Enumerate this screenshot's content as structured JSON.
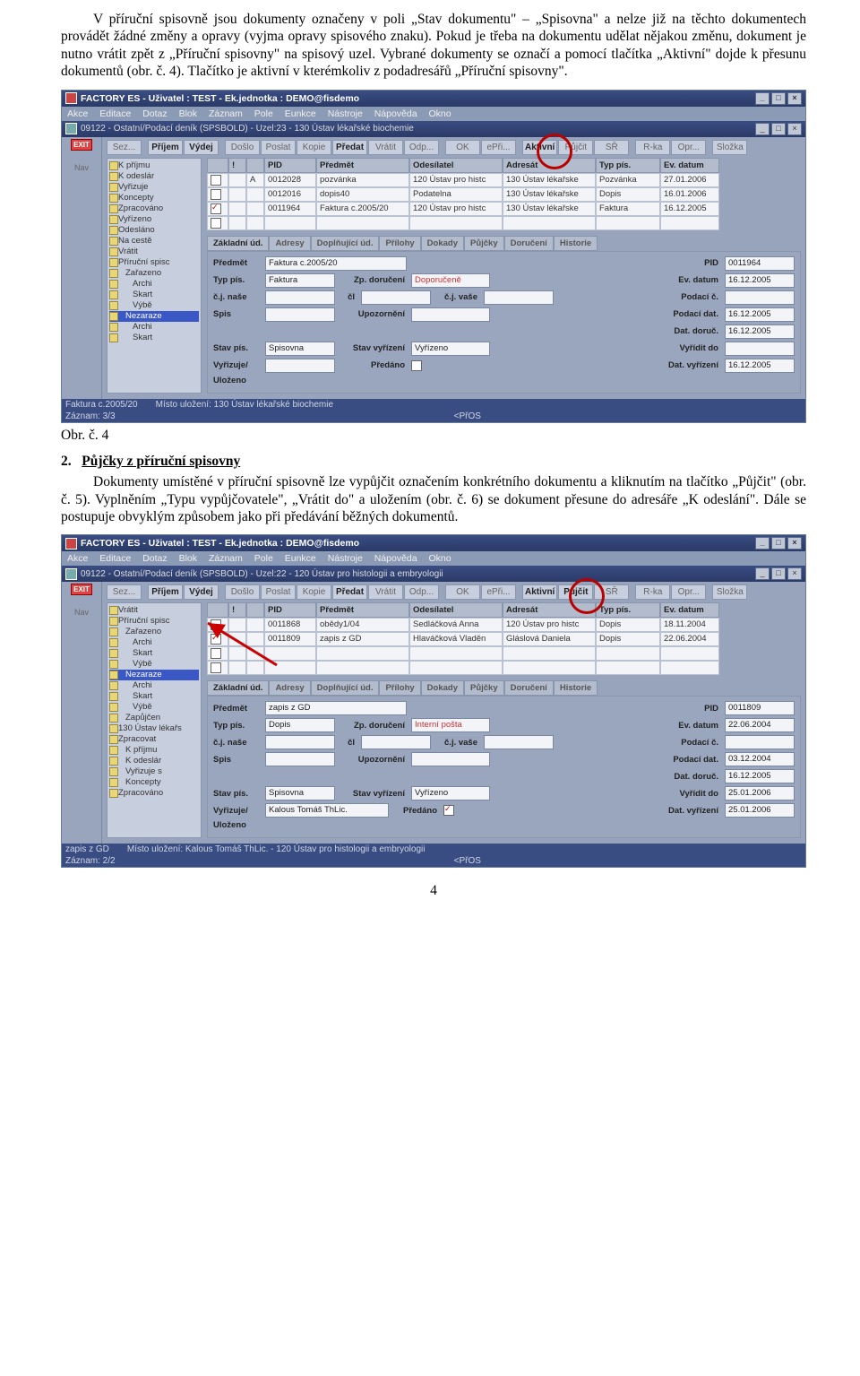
{
  "para1": "V příruční spisovně jsou dokumenty označeny v poli „Stav dokumentu\" – „Spisovna\" a nelze již na těchto dokumentech provádět žádné změny a opravy (vyjma opravy spisového znaku). Pokud je třeba na dokumentu udělat nějakou změnu, dokument je nutno vrátit zpět z „Příruční spisovny\" na spisový uzel. Vybrané dokumenty se označí a pomocí tlačítka „Aktivní\" dojde k přesunu dokumentů (obr. č. 4). Tlačítko je aktivní v kterémkoliv z podadresářů „Příruční spisovny\".",
  "caption1": "Obr. č. 4",
  "sec_num": "2.",
  "sec_title": "Půjčky z příruční spisovny",
  "para2": "Dokumenty umístěné v příruční spisovně lze vypůjčit označením konkrétního dokumentu a kliknutím na tlačítko „Půjčit\" (obr. č. 5). Vyplněním „Typu vypůjčovatele\", „Vrátit do\" a uložením (obr. č. 6) se dokument přesune do adresáře „K odeslání\". Dále se postupuje obvyklým způsobem jako při předávání běžných dokumentů.",
  "page": "4",
  "s1": {
    "title": "FACTORY ES - Uživatel : TEST - Ek.jednotka : DEMO@fisdemo",
    "menu": [
      "Akce",
      "Editace",
      "Dotaz",
      "Blok",
      "Záznam",
      "Pole",
      "Eunkce",
      "Nástroje",
      "Nápověda",
      "Okno"
    ],
    "doc": "09122 - Ostatní/Podací deník (SPSBOLD) - Uzel:23 - 130 Ústav lékařské biochemie",
    "btns": [
      "Sez...",
      "Příjem",
      "Výdej",
      "Došlo",
      "Poslat",
      "Kopie",
      "Předat",
      "Vrátit",
      "Odp...",
      "OK",
      "ePři...",
      "Aktivní",
      "Půjčit",
      "SŘ",
      "R-ka",
      "Opr...",
      "Složka"
    ],
    "nav": "Nav",
    "tree": [
      "K příjmu",
      "K odeslár",
      "Vyřizuje",
      "Koncepty",
      "Zpracováno",
      "Vyřízeno",
      "Odesláno",
      "Na cestě",
      "Vrátit",
      "Příruční spisc",
      "Zařazeno",
      "Archi",
      "Skart",
      "Výbě",
      "Nezaraze",
      "Archi",
      "Skart"
    ],
    "tree_sel": "Nezaraze",
    "gh": [
      "",
      "!",
      "",
      "PID",
      "Předmět",
      "Odesílatel",
      "Adresát",
      "Typ pís.",
      "Ev. datum"
    ],
    "rows": [
      {
        "ck": false,
        "mk": "",
        "t": "A",
        "pid": "0012028",
        "pred": "pozvánka",
        "od": "120 Ústav pro histc",
        "ad": "130 Ústav lékařske",
        "typ": "Pozvánka",
        "dt": "27.01.2006"
      },
      {
        "ck": false,
        "mk": "",
        "t": "",
        "pid": "0012016",
        "pred": "dopis40",
        "od": "Podatelna",
        "ad": "130 Ústav lékařske",
        "typ": "Dopis",
        "dt": "16.01.2006"
      },
      {
        "ck": true,
        "mk": "",
        "t": "",
        "pid": "0011964",
        "pred": "Faktura c.2005/20",
        "od": "120 Ústav pro histc",
        "ad": "130 Ústav lékařske",
        "typ": "Faktura",
        "dt": "16.12.2005"
      }
    ],
    "tabs": [
      "Základní úd.",
      "Adresy",
      "Doplňující úd.",
      "Přílohy",
      "Dokady",
      "Půjčky",
      "Doručení",
      "Historie"
    ],
    "form": {
      "predmet_l": "Předmět",
      "predmet": "Faktura c.2005/20",
      "typ_l": "Typ pís.",
      "typ": "Faktura",
      "cjnase_l": "č.j. naše",
      "cjnase": "",
      "spis_l": "Spis",
      "spis": "",
      "stav_l": "Stav pís.",
      "stav": "Spisovna",
      "vyr_l": "Vyřizuje/",
      "vyr": "",
      "ul_l": "Uloženo",
      "zp_l": "Zp. doručení",
      "zp": "Doporučeně",
      "cl_l": "čl",
      "cjvase_l": "č.j. vaše",
      "cjvase": "",
      "upoz_l": "Upozornění",
      "upoz": "",
      "stavv_l": "Stav vyřízení",
      "stavv": "Vyřízeno",
      "pred_l": "Předáno",
      "pid_l": "PID",
      "pid": "0011964",
      "evd_l": "Ev. datum",
      "evd": "16.12.2005",
      "pod_l": "Podací č.",
      "pod": "",
      "podd_l": "Podací dat.",
      "podd": "16.12.2005",
      "datd_l": "Dat. doruč.",
      "datd": "16.12.2005",
      "vyrd_l": "Vyřídit do",
      "vyrd": "",
      "datv_l": "Dat. vyřízení",
      "datv": "16.12.2005"
    },
    "status": [
      "Faktura c.2005/20",
      "Místo uložení: 130 Ústav lékařské biochemie"
    ],
    "status2": [
      "Záznam: 3/3",
      "",
      "<PřOS"
    ]
  },
  "s2": {
    "title": "FACTORY ES - Uživatel : TEST - Ek.jednotka : DEMO@fisdemo",
    "menu": [
      "Akce",
      "Editace",
      "Dotaz",
      "Blok",
      "Záznam",
      "Pole",
      "Eunkce",
      "Nástroje",
      "Nápověda",
      "Okno"
    ],
    "doc": "09122 - Ostatní/Podací deník (SPSBOLD) - Uzel:22 - 120 Ústav pro histologii a embryologii",
    "btns": [
      "Sez...",
      "Příjem",
      "Výdej",
      "Došlo",
      "Poslat",
      "Kopie",
      "Předat",
      "Vrátit",
      "Odp...",
      "OK",
      "ePři...",
      "Aktivní",
      "Půjčit",
      "SŘ",
      "R-ka",
      "Opr...",
      "Složka"
    ],
    "tree": [
      "Vrátit",
      "Příruční spisc",
      "Zařazeno",
      "Archi",
      "Skart",
      "Výbě",
      "Nezaraze",
      "Archi",
      "Skart",
      "Výbě",
      "Zapůjčen",
      "130 Ústav lékařs",
      "Zpracovat",
      "K příjmu",
      "K odeslár",
      "Vyřizuje s",
      "Koncepty",
      "Zpracováno"
    ],
    "tree_sel": "Nezaraze",
    "gh": [
      "",
      "!",
      "",
      "PID",
      "Předmět",
      "Odesílatel",
      "Adresát",
      "Typ pís.",
      "Ev. datum"
    ],
    "rows": [
      {
        "ck": false,
        "mk": "",
        "t": "",
        "pid": "0011868",
        "pred": "obědy1/04",
        "od": "Sedláčková Anna",
        "ad": "120 Ústav pro histc",
        "typ": "Dopis",
        "dt": "18.11.2004"
      },
      {
        "ck": true,
        "mk": "",
        "t": "",
        "pid": "0011809",
        "pred": "zapis z GD",
        "od": "Hlaváčková Vladěn",
        "ad": "Gláslová Daniela",
        "typ": "Dopis",
        "dt": "22.06.2004"
      }
    ],
    "tabs": [
      "Základní úd.",
      "Adresy",
      "Doplňující úd.",
      "Přílohy",
      "Dokady",
      "Půjčky",
      "Doručení",
      "Historie"
    ],
    "form": {
      "predmet_l": "Předmět",
      "predmet": "zapis z GD",
      "typ_l": "Typ pís.",
      "typ": "Dopis",
      "cjnase_l": "č.j. naše",
      "cjnase": "",
      "spis_l": "Spis",
      "spis": "",
      "stav_l": "Stav pís.",
      "stav": "Spisovna",
      "vyr_l": "Vyřizuje/",
      "vyr": "Kalous Tomáš ThLic.",
      "ul_l": "Uloženo",
      "zp_l": "Zp. doručení",
      "zp": "Interní pošta",
      "cl_l": "čl",
      "cjvase_l": "č.j. vaše",
      "cjvase": "",
      "upoz_l": "Upozornění",
      "upoz": "",
      "stavv_l": "Stav vyřízení",
      "stavv": "Vyřízeno",
      "pred_l": "Předáno",
      "pid_l": "PID",
      "pid": "0011809",
      "evd_l": "Ev. datum",
      "evd": "22.06.2004",
      "pod_l": "Podací č.",
      "pod": "",
      "podd_l": "Podací dat.",
      "podd": "03.12.2004",
      "datd_l": "Dat. doruč.",
      "datd": "16.12.2005",
      "vyrd_l": "Vyřídit do",
      "vyrd": "25.01.2006",
      "datv_l": "Dat. vyřízení",
      "datv": "25.01.2006"
    },
    "status": [
      "zapis z GD",
      "Místo uložení: Kalous Tomáš ThLic. - 120 Ústav pro histologii a embryologii"
    ],
    "status2": [
      "Záznam: 2/2",
      "",
      "<PřOS"
    ]
  }
}
